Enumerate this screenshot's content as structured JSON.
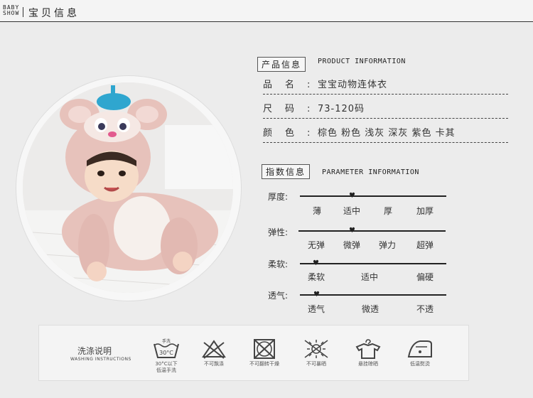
{
  "header": {
    "logo_line1": "BABY",
    "logo_line2": "SHOW",
    "title": "宝贝信息"
  },
  "product": {
    "label": "产品信息",
    "en_label": "PRODUCT INFORMATION",
    "rows": [
      {
        "key": "品名:",
        "value": "宝宝动物连体衣"
      },
      {
        "key": "尺码:",
        "value": "73-120码"
      },
      {
        "key": "颜色:",
        "value": "棕色 粉色 浅灰 深灰 紫色 卡其"
      }
    ]
  },
  "parameters": {
    "label": "指数信息",
    "en_label": "PARAMETER INFORMATION",
    "rows": [
      {
        "name": "厚度:",
        "options": [
          "薄",
          "适中",
          "厚",
          "加厚"
        ],
        "selected": 1
      },
      {
        "name": "弹性:",
        "options": [
          "无弹",
          "微弹",
          "弹力",
          "超弹"
        ],
        "selected": 1
      },
      {
        "name": "柔软:",
        "options": [
          "柔软",
          "适中",
          "偏硬"
        ],
        "selected": 0
      },
      {
        "name": "透气:",
        "options": [
          "透气",
          "微透",
          "不透"
        ],
        "selected": 0
      }
    ]
  },
  "washing": {
    "title": "洗涤说明",
    "en_title": "WASHING INSTRUCTIONS",
    "items": [
      {
        "icon": "hand-wash-icon",
        "badge": "手洗",
        "temp": "30°C",
        "caption": "30°C以下\n低温手洗"
      },
      {
        "icon": "no-bleach-icon",
        "caption": "不可飘涤"
      },
      {
        "icon": "no-tumble-dry-icon",
        "caption": "不可翻转干燥"
      },
      {
        "icon": "no-sun-dry-icon",
        "caption": "不可暴晒"
      },
      {
        "icon": "hang-dry-icon",
        "caption": "悬挂晾晒"
      },
      {
        "icon": "low-iron-icon",
        "caption": "低温熨烫"
      }
    ]
  },
  "colors": {
    "hat": "#2fa6cf",
    "costume": "#e7c2bb",
    "nose": "#e25a8e"
  }
}
